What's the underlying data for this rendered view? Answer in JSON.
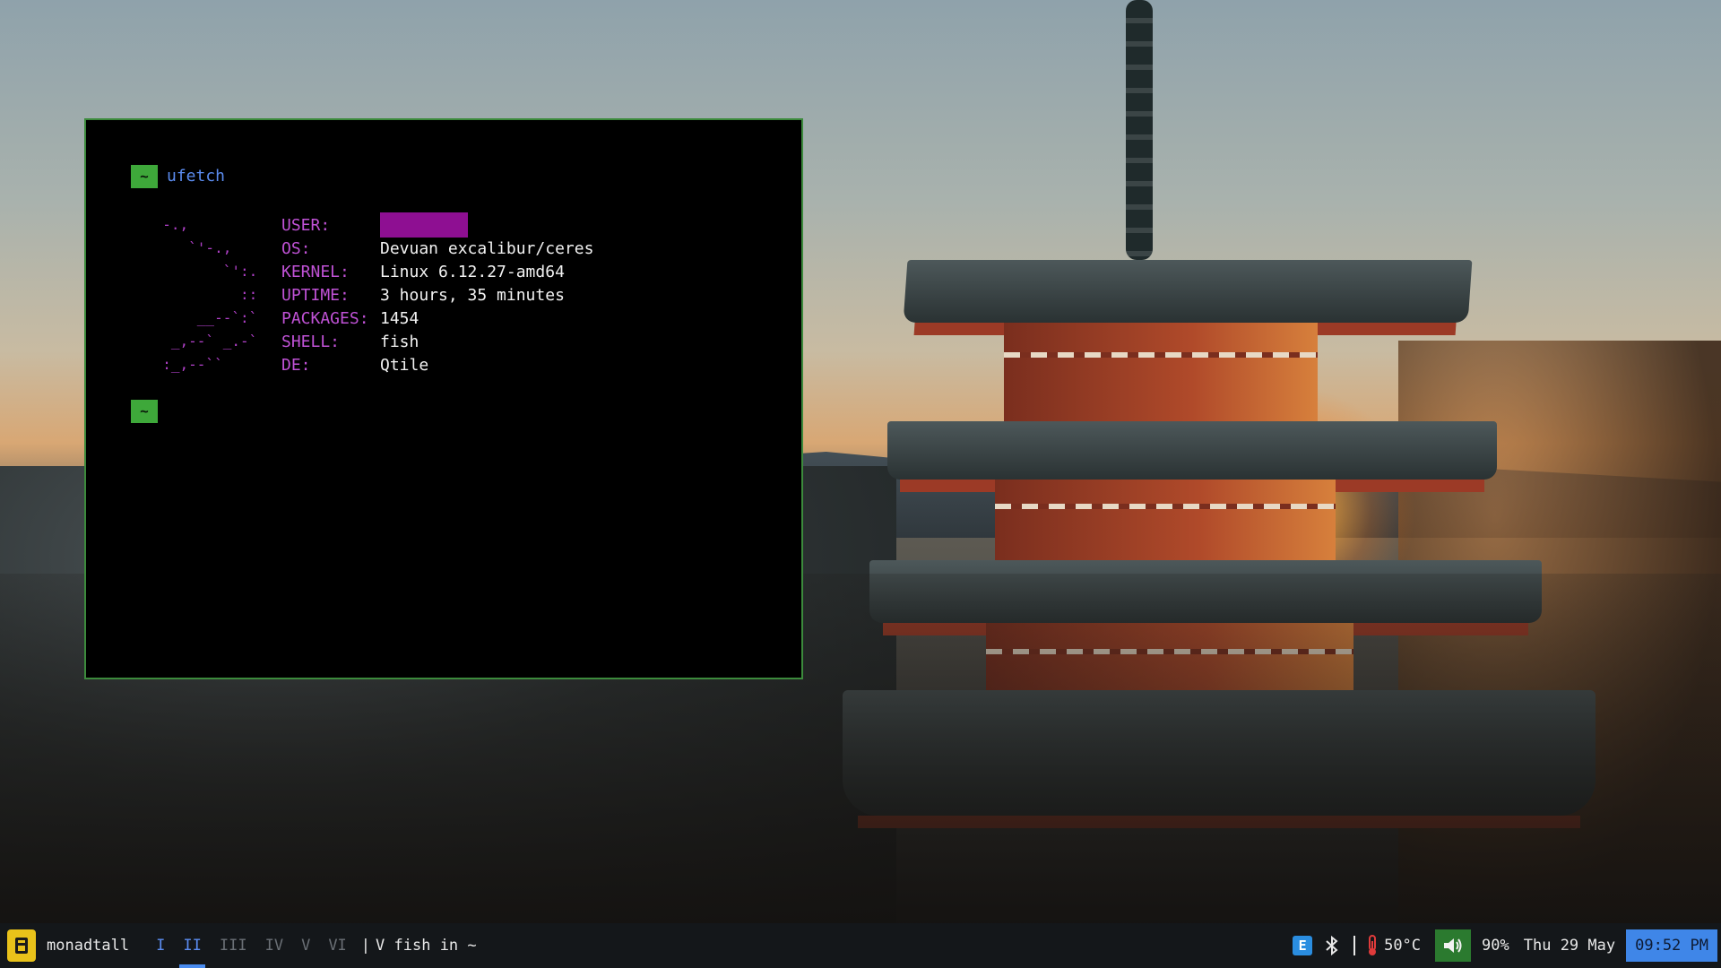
{
  "terminal": {
    "prompt_symbol": "~",
    "command": "ufetch",
    "logo": "  -.,\n     `'-.,\n         `':.\n           ::\n      __--`:`\n   _,--` _.-`\n  :_,--``",
    "info": [
      {
        "key": "USER:",
        "value": "",
        "redacted": true
      },
      {
        "key": "OS:",
        "value": "Devuan excalibur/ceres"
      },
      {
        "key": "KERNEL:",
        "value": "Linux 6.12.27-amd64"
      },
      {
        "key": "UPTIME:",
        "value": "3 hours, 35 minutes"
      },
      {
        "key": "PACKAGES:",
        "value": "1454"
      },
      {
        "key": "SHELL:",
        "value": "fish"
      },
      {
        "key": "DE:",
        "value": "Qtile"
      }
    ]
  },
  "bar": {
    "layout_name": "monadtall",
    "workspaces": [
      {
        "label": "I",
        "state": "occupied"
      },
      {
        "label": "II",
        "state": "active"
      },
      {
        "label": "III",
        "state": "empty"
      },
      {
        "label": "IV",
        "state": "empty"
      },
      {
        "label": "V",
        "state": "empty"
      },
      {
        "label": "VI",
        "state": "empty"
      }
    ],
    "separator": "|",
    "window_title": "V fish in ~",
    "e_badge": "E",
    "temperature": "50°C",
    "volume": "90%",
    "date": "Thu 29 May",
    "time": "09:52 PM",
    "colors": {
      "accent_blue": "#3f86e8",
      "volume_green": "#2b7a2f",
      "layout_yellow": "#e9c21a",
      "terminal_border": "#3c8a3c",
      "ufetch_magenta": "#c052d6"
    },
    "icons": [
      "layout-icon",
      "bluetooth-icon",
      "thermometer-icon",
      "volume-icon"
    ]
  }
}
